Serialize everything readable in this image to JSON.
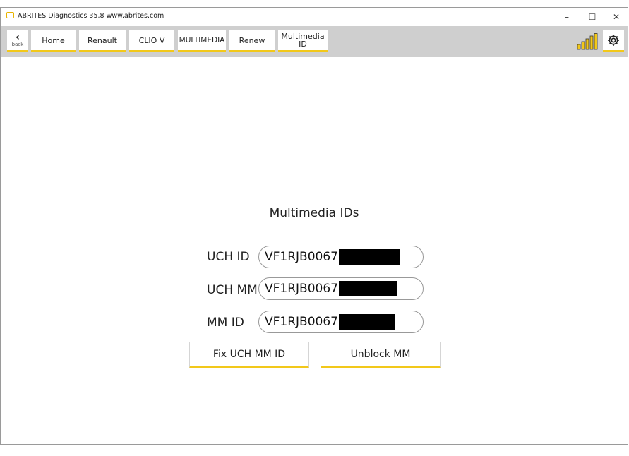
{
  "window": {
    "title": "ABRITES Diagnostics 35.8   www.abrites.com",
    "minimize": "–",
    "maximize": "☐",
    "close": "✕"
  },
  "toolbar": {
    "back_label": "back",
    "back_glyph": "‹",
    "breadcrumbs": [
      "Home",
      "Renault",
      "CLIO V",
      "MULTIMEDIA",
      "Renew",
      "Multimedia ID"
    ],
    "signal_icon": "signal-strength-icon",
    "settings_icon": "gear-icon",
    "accent": "#f2c81a"
  },
  "main": {
    "heading": "Multimedia IDs",
    "rows": [
      {
        "label": "UCH ID",
        "value": "VF1RJB0067"
      },
      {
        "label": "UCH MM",
        "value": "VF1RJB0067"
      },
      {
        "label": "MM ID",
        "value": "VF1RJB0067"
      }
    ],
    "buttons": {
      "fix": "Fix UCH MM ID",
      "unblock": "Unblock MM"
    }
  }
}
